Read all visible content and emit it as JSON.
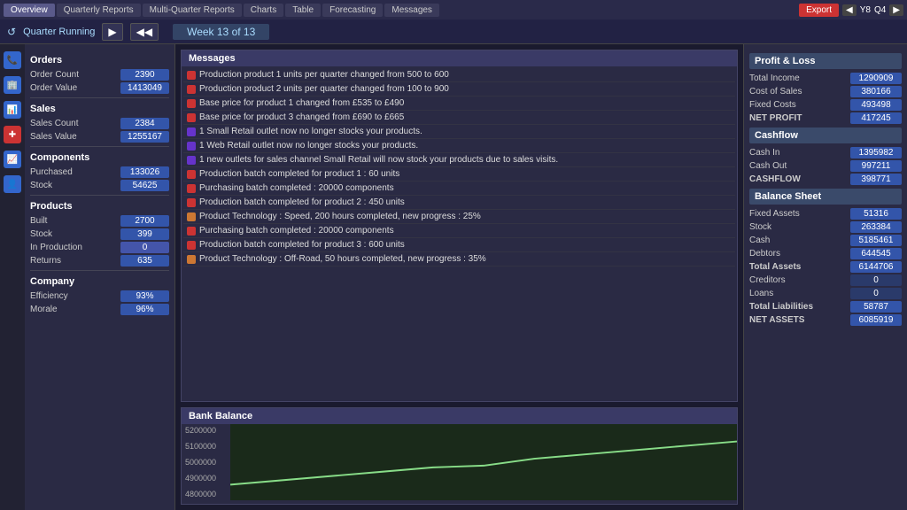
{
  "topNav": {
    "tabs": [
      {
        "label": "Overview",
        "active": true
      },
      {
        "label": "Quarterly Reports",
        "active": false
      },
      {
        "label": "Multi-Quarter Reports",
        "active": false
      },
      {
        "label": "Charts",
        "active": false
      },
      {
        "label": "Table",
        "active": false
      },
      {
        "label": "Forecasting",
        "active": false
      },
      {
        "label": "Messages",
        "active": false
      }
    ],
    "export_label": "Export",
    "year_label": "Y8",
    "quarter_label": "Q4",
    "arrow_left": "◀",
    "arrow_right": "▶"
  },
  "subHeader": {
    "quarter_running": "Quarter Running",
    "play_icon": "▶",
    "rewind_icon": "◀◀",
    "week_label": "Week 13 of 13"
  },
  "leftPanel": {
    "orders_title": "Orders",
    "order_count_label": "Order Count",
    "order_count_value": "2390",
    "order_value_label": "Order Value",
    "order_value_value": "1413049",
    "sales_title": "Sales",
    "sales_count_label": "Sales Count",
    "sales_count_value": "2384",
    "sales_value_label": "Sales Value",
    "sales_value_value": "1255167",
    "components_title": "Components",
    "purchased_label": "Purchased",
    "purchased_value": "133026",
    "stock_label": "Stock",
    "stock_value": "54625",
    "products_title": "Products",
    "built_label": "Built",
    "built_value": "2700",
    "stock2_label": "Stock",
    "stock2_value": "399",
    "in_production_label": "In Production",
    "in_production_value": "0",
    "returns_label": "Returns",
    "returns_value": "635",
    "company_title": "Company",
    "efficiency_label": "Efficiency",
    "efficiency_value": "93%",
    "morale_label": "Morale",
    "morale_value": "96%"
  },
  "messages": {
    "title": "Messages",
    "items": [
      {
        "dot": "red",
        "text": "Production product 1 units per quarter changed from 500 to 600"
      },
      {
        "dot": "red",
        "text": "Production product 2 units per quarter changed from 100 to 900"
      },
      {
        "dot": "red",
        "text": "Base price for product 1 changed from £535 to £490"
      },
      {
        "dot": "red",
        "text": "Base price for product 3 changed from £690 to £665"
      },
      {
        "dot": "purple",
        "text": "1 Small Retail outlet now no longer stocks your products."
      },
      {
        "dot": "purple",
        "text": "1 Web Retail outlet now no longer stocks your products."
      },
      {
        "dot": "purple",
        "text": "1 new outlets for sales channel Small Retail will now stock your products due to sales visits."
      },
      {
        "dot": "red",
        "text": "Production batch completed for product 1 : 60 units"
      },
      {
        "dot": "red",
        "text": "Purchasing batch completed : 20000 components"
      },
      {
        "dot": "red",
        "text": "Production batch completed for product 2 : 450 units"
      },
      {
        "dot": "orange",
        "text": "Product Technology : Speed, 200 hours completed, new progress : 25%"
      },
      {
        "dot": "red",
        "text": "Purchasing batch completed : 20000 components"
      },
      {
        "dot": "red",
        "text": "Production batch completed for product 3 : 600 units"
      },
      {
        "dot": "orange",
        "text": "Product Technology : Off-Road, 50 hours completed, new progress : 35%"
      }
    ]
  },
  "bankBalance": {
    "title": "Bank Balance",
    "chart_labels": [
      "5200000",
      "5100000",
      "5000000",
      "4900000",
      "4800000"
    ]
  },
  "profitLoss": {
    "title": "Profit & Loss",
    "total_income_label": "Total Income",
    "total_income_value": "1290909",
    "cost_of_sales_label": "Cost of Sales",
    "cost_of_sales_value": "380166",
    "fixed_costs_label": "Fixed Costs",
    "fixed_costs_value": "493498",
    "net_profit_label": "NET PROFIT",
    "net_profit_value": "417245"
  },
  "cashflow": {
    "title": "Cashflow",
    "cash_in_label": "Cash In",
    "cash_in_value": "1395982",
    "cash_out_label": "Cash Out",
    "cash_out_value": "997211",
    "cashflow_label": "CASHFLOW",
    "cashflow_value": "398771"
  },
  "balanceSheet": {
    "title": "Balance Sheet",
    "fixed_assets_label": "Fixed Assets",
    "fixed_assets_value": "51316",
    "stock_label": "Stock",
    "stock_value": "263384",
    "cash_label": "Cash",
    "cash_value": "5185461",
    "debtors_label": "Debtors",
    "debtors_value": "644545",
    "total_assets_label": "Total Assets",
    "total_assets_value": "6144706",
    "creditors_label": "Creditors",
    "creditors_value": "0",
    "loans_label": "Loans",
    "loans_value": "0",
    "total_liabilities_label": "Total Liabilities",
    "total_liabilities_value": "58787",
    "net_assets_label": "NET ASSETS",
    "net_assets_value": "6085919"
  }
}
